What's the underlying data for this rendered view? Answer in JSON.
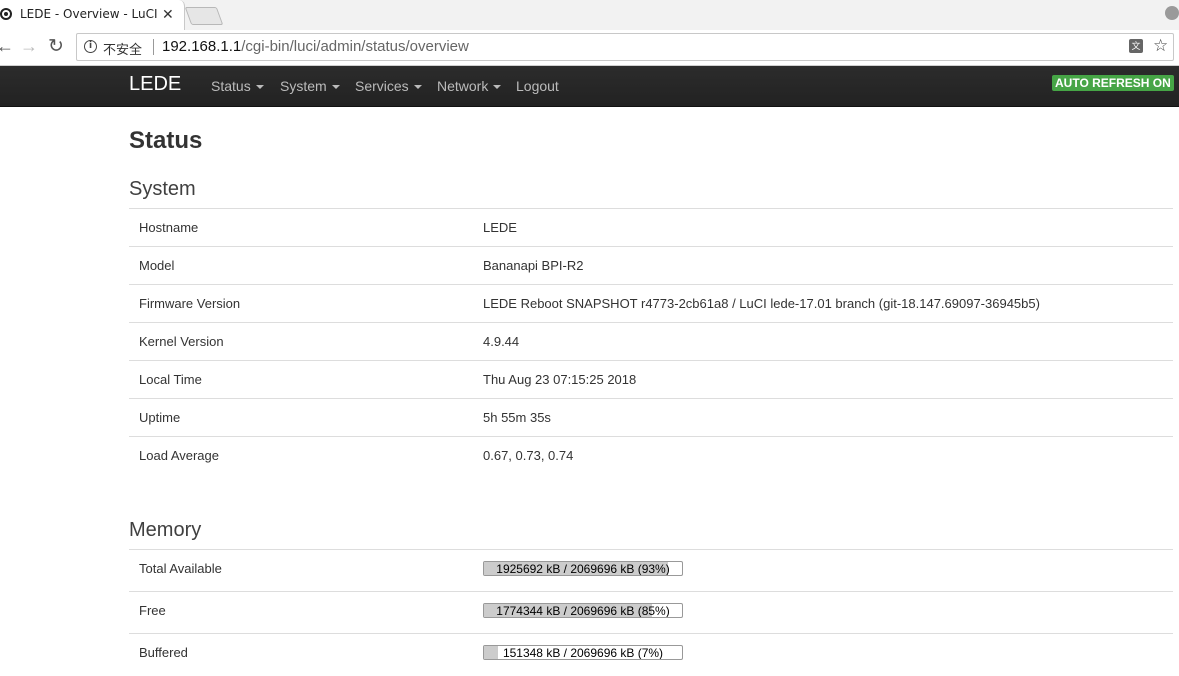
{
  "browser": {
    "tab_title": "LEDE - Overview - LuCI",
    "tab_close": "✕",
    "security_label": "不安全",
    "url_host": "192.168.1.1",
    "url_path": "/cgi-bin/luci/admin/status/overview"
  },
  "header": {
    "brand": "LEDE",
    "menu": [
      "Status",
      "System",
      "Services",
      "Network",
      "Logout"
    ],
    "auto_refresh": "AUTO REFRESH ON",
    "auto_refresh_color": "#46a546"
  },
  "page": {
    "title": "Status"
  },
  "system": {
    "title": "System",
    "rows": [
      {
        "key": "Hostname",
        "value": "LEDE"
      },
      {
        "key": "Model",
        "value": "Bananapi BPI-R2"
      },
      {
        "key": "Firmware Version",
        "value": "LEDE Reboot SNAPSHOT r4773-2cb61a8 / LuCI lede-17.01 branch (git-18.147.69097-36945b5)"
      },
      {
        "key": "Kernel Version",
        "value": "4.9.44"
      },
      {
        "key": "Local Time",
        "value": "Thu Aug 23 07:15:25 2018"
      },
      {
        "key": "Uptime",
        "value": "5h 55m 35s"
      },
      {
        "key": "Load Average",
        "value": "0.67, 0.73, 0.74"
      }
    ]
  },
  "memory": {
    "title": "Memory",
    "rows": [
      {
        "key": "Total Available",
        "text": "1925692 kB / 2069696 kB (93%)",
        "percent": 93
      },
      {
        "key": "Free",
        "text": "1774344 kB / 2069696 kB (85%)",
        "percent": 85
      },
      {
        "key": "Buffered",
        "text": "151348 kB / 2069696 kB (7%)",
        "percent": 7
      }
    ]
  }
}
